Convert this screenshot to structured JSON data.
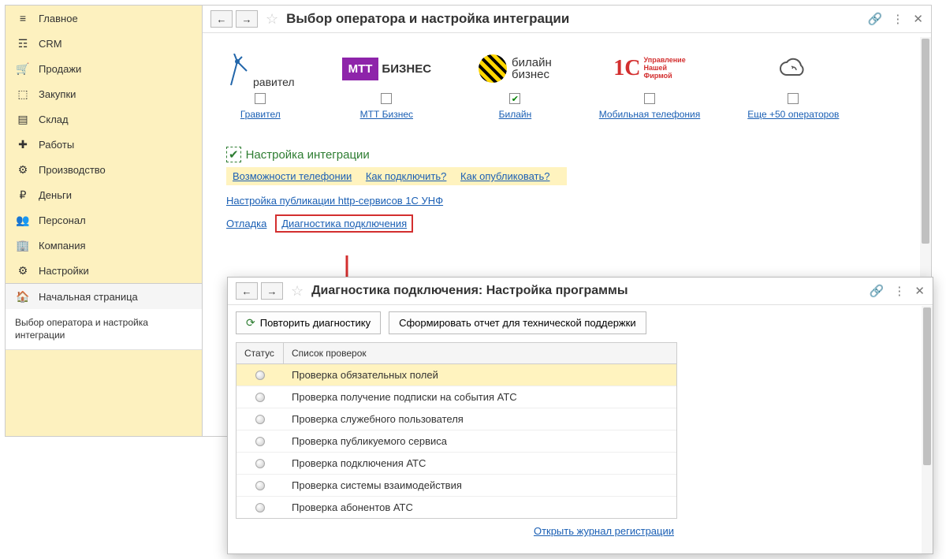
{
  "sidebar": {
    "items": [
      {
        "label": "Главное",
        "icon": "menu"
      },
      {
        "label": "CRM",
        "icon": "crm"
      },
      {
        "label": "Продажи",
        "icon": "cart"
      },
      {
        "label": "Закупки",
        "icon": "box-in"
      },
      {
        "label": "Склад",
        "icon": "warehouse"
      },
      {
        "label": "Работы",
        "icon": "wrench"
      },
      {
        "label": "Производство",
        "icon": "factory"
      },
      {
        "label": "Деньги",
        "icon": "money"
      },
      {
        "label": "Персонал",
        "icon": "people"
      },
      {
        "label": "Компания",
        "icon": "company"
      },
      {
        "label": "Настройки",
        "icon": "gear"
      }
    ],
    "home_label": "Начальная страница",
    "current_page": "Выбор оператора и настройка интеграции"
  },
  "main": {
    "title": "Выбор оператора и настройка интеграции",
    "operators": [
      {
        "name": "Гравител",
        "checked": false,
        "logo_text": "равител"
      },
      {
        "name": "МТТ Бизнес",
        "checked": false,
        "badge": "МТТ",
        "suffix": "БИЗНЕС"
      },
      {
        "name": "Билайн",
        "checked": true,
        "line1": "билайн",
        "line2": "бизнес"
      },
      {
        "name": "Мобильная телефония",
        "checked": false,
        "badge": "1C",
        "line1": "Управление",
        "line2": "Нашей",
        "line3": "Фирмой"
      },
      {
        "name": "Еще +50 операторов",
        "checked": false
      }
    ],
    "settings_header": "Настройка интеграции",
    "yellow_links": [
      "Возможности телефонии",
      "Как подключить?",
      "Как опубликовать?"
    ],
    "link_http": "Настройка публикации http-сервисов 1С УНФ",
    "link_debug": "Отладка",
    "link_diag": "Диагностика подключения"
  },
  "dialog": {
    "title": "Диагностика подключения: Настройка программы",
    "btn_repeat": "Повторить диагностику",
    "btn_report": "Сформировать отчет для технической поддержки",
    "col_status": "Статус",
    "col_checks": "Список проверок",
    "checks": [
      "Проверка обязательных полей",
      "Проверка получение подписки на события АТС",
      "Проверка служебного пользователя",
      "Проверка публикуемого сервиса",
      "Проверка подключения АТС",
      "Проверка системы взаимодействия",
      "Проверка абонентов АТС"
    ],
    "footer_link": "Открыть журнал регистрации"
  }
}
